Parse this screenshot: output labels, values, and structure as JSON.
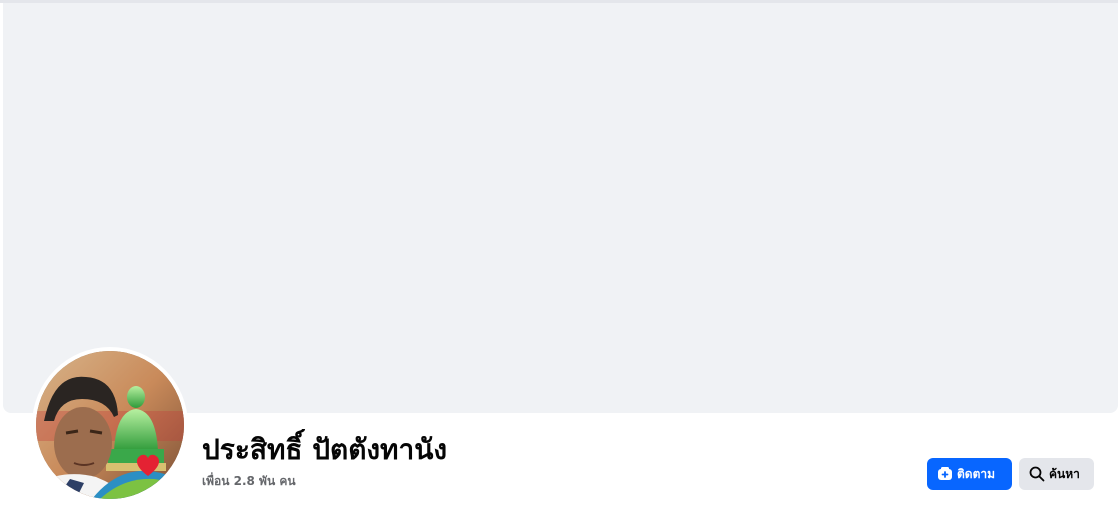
{
  "profile": {
    "name": "ประสิทธิ์ ปัตตังทานัง",
    "friends_text": "เพื่อน 2.8 พัน คน"
  },
  "actions": {
    "follow_label": "ติดตาม",
    "follow_icon": "follow-add-icon",
    "search_label": "ค้นหา",
    "search_icon": "magnifier-icon"
  },
  "colors": {
    "cover_background": "#f0f2f5",
    "primary_button": "#0866ff",
    "secondary_button": "#e4e6eb",
    "muted_text": "#65676b"
  }
}
